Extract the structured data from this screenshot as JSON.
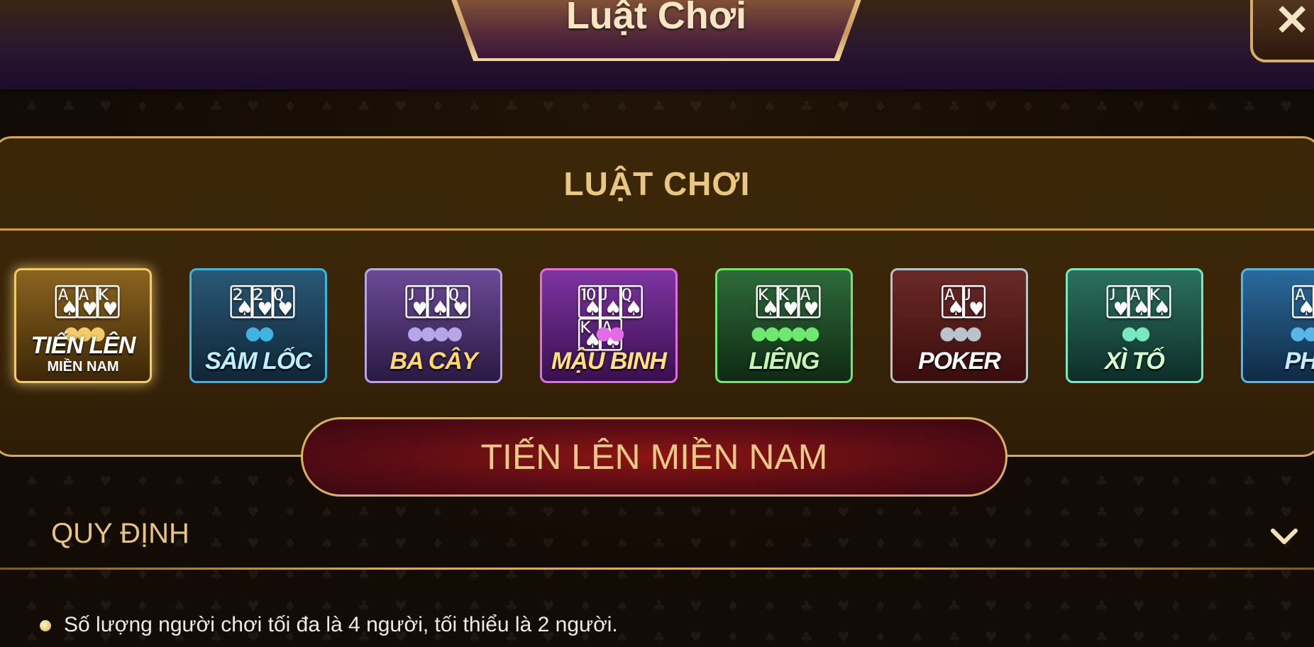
{
  "header": {
    "title": "Luật Chơi",
    "close_label": "✕"
  },
  "panel": {
    "title": "LUẬT CHƠI"
  },
  "games": [
    {
      "label": "TIẾN LÊN",
      "sub": "MIỀN NAM",
      "selected": true,
      "border": "#f2cc6a",
      "bg_top": "#8a6420",
      "bg_bottom": "#3d2606",
      "text_color": "#ffffff"
    },
    {
      "label": "SÂM LỐC",
      "sub": "",
      "selected": false,
      "border": "#3fb4e0",
      "bg_top": "#2a5876",
      "bg_bottom": "#0f2637",
      "text_color": "#bff0ff"
    },
    {
      "label": "BA CÂY",
      "sub": "",
      "selected": false,
      "border": "#b6a6e8",
      "bg_top": "#6b4a96",
      "bg_bottom": "#2a1a42",
      "text_color": "#ffd866"
    },
    {
      "label": "MẬU BINH",
      "sub": "",
      "selected": false,
      "border": "#e36be6",
      "bg_top": "#7d34a0",
      "bg_bottom": "#3a1050",
      "text_color": "#ffe27a"
    },
    {
      "label": "LIÊNG",
      "sub": "",
      "selected": false,
      "border": "#6ee86e",
      "bg_top": "#2e6a3a",
      "bg_bottom": "#0f2a14",
      "text_color": "#c8f5b6"
    },
    {
      "label": "POKER",
      "sub": "",
      "selected": false,
      "border": "#b8c4cc",
      "bg_top": "#6a2a26",
      "bg_bottom": "#3a0d0d",
      "text_color": "#ffffff"
    },
    {
      "label": "XÌ TỐ",
      "sub": "",
      "selected": false,
      "border": "#78e8c0",
      "bg_top": "#2c7060",
      "bg_bottom": "#0d2e28",
      "text_color": "#d9ffd0"
    },
    {
      "label": "PHỎ",
      "sub": "",
      "selected": false,
      "border": "#56b6e6",
      "bg_top": "#2a6a9c",
      "bg_bottom": "#0f2a44",
      "text_color": "#c8ecff"
    }
  ],
  "selected_game": "TIẾN LÊN MIỀN NAM",
  "rules": {
    "section_title": "QUY ĐỊNH",
    "items": [
      "Số lượng người chơi tối đa là 4 người, tối thiểu là 2 người."
    ]
  },
  "colors": {
    "gold": "#d4a94f",
    "banner_red": "#8c1612",
    "text_gold": "#e9c77f"
  }
}
